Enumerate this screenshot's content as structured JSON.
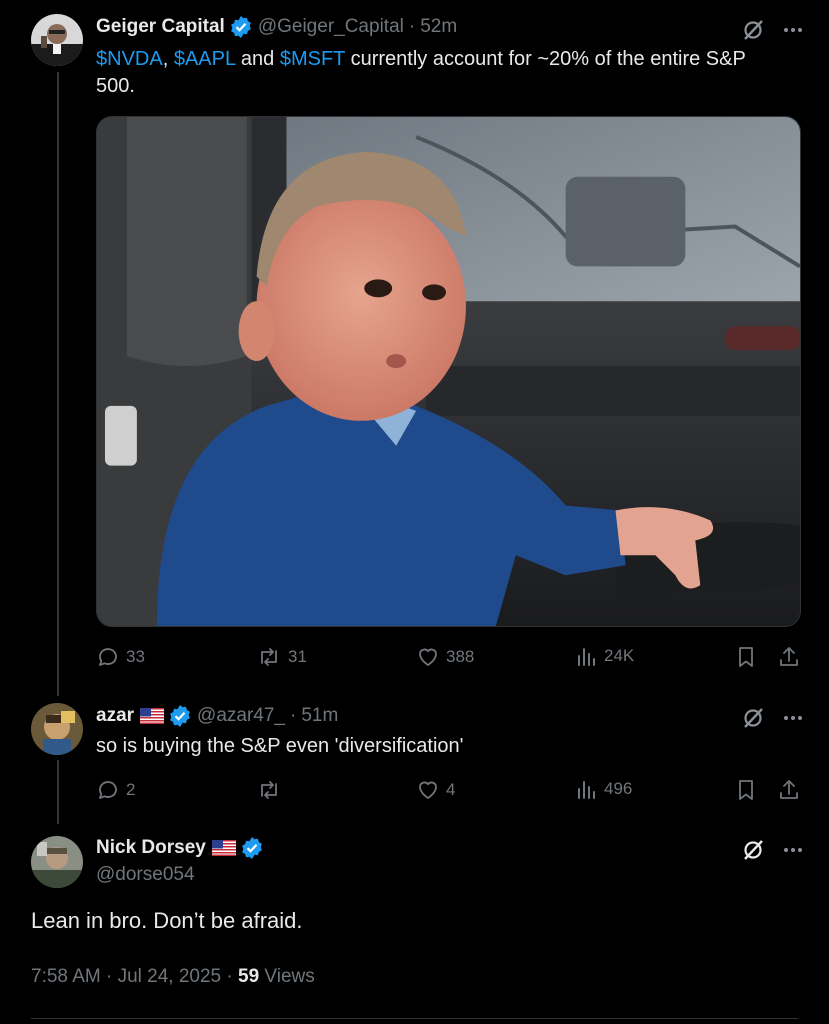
{
  "tweet": {
    "author": {
      "name": "Geiger Capital",
      "handle": "@Geiger_Capital",
      "time": "52m"
    },
    "text": {
      "t1": "$NVDA",
      "t2": ", ",
      "t3": "$AAPL",
      "t4": " and ",
      "t5": "$MSFT",
      "t6": " currently account for ~20% of the entire S&P",
      "t7": "500."
    },
    "stats": {
      "replies": "33",
      "reposts": "31",
      "likes": "388",
      "views": "24K"
    }
  },
  "reply": {
    "author": {
      "name": "azar",
      "handle": "@azar47_",
      "time": "51m"
    },
    "text": "so is buying the S&P even 'diversification'",
    "stats": {
      "replies": "2",
      "reposts": "",
      "likes": "4",
      "views": "496"
    }
  },
  "focused": {
    "author": {
      "name": "Nick Dorsey",
      "handle": "@dorse054"
    },
    "text": "Lean in bro. Don’t be afraid.",
    "time": "7:58 AM · Jul 24, 2025 · ",
    "views_count": "59",
    "views_label": " Views"
  },
  "colors": {
    "accent": "#1d9bf0",
    "muted": "#71767b",
    "background": "#000000"
  },
  "icons": [
    "grok-icon",
    "more-icon",
    "reply-icon",
    "repost-icon",
    "like-icon",
    "views-icon",
    "bookmark-icon",
    "share-icon",
    "verified-badge-icon",
    "us-flag-icon"
  ]
}
